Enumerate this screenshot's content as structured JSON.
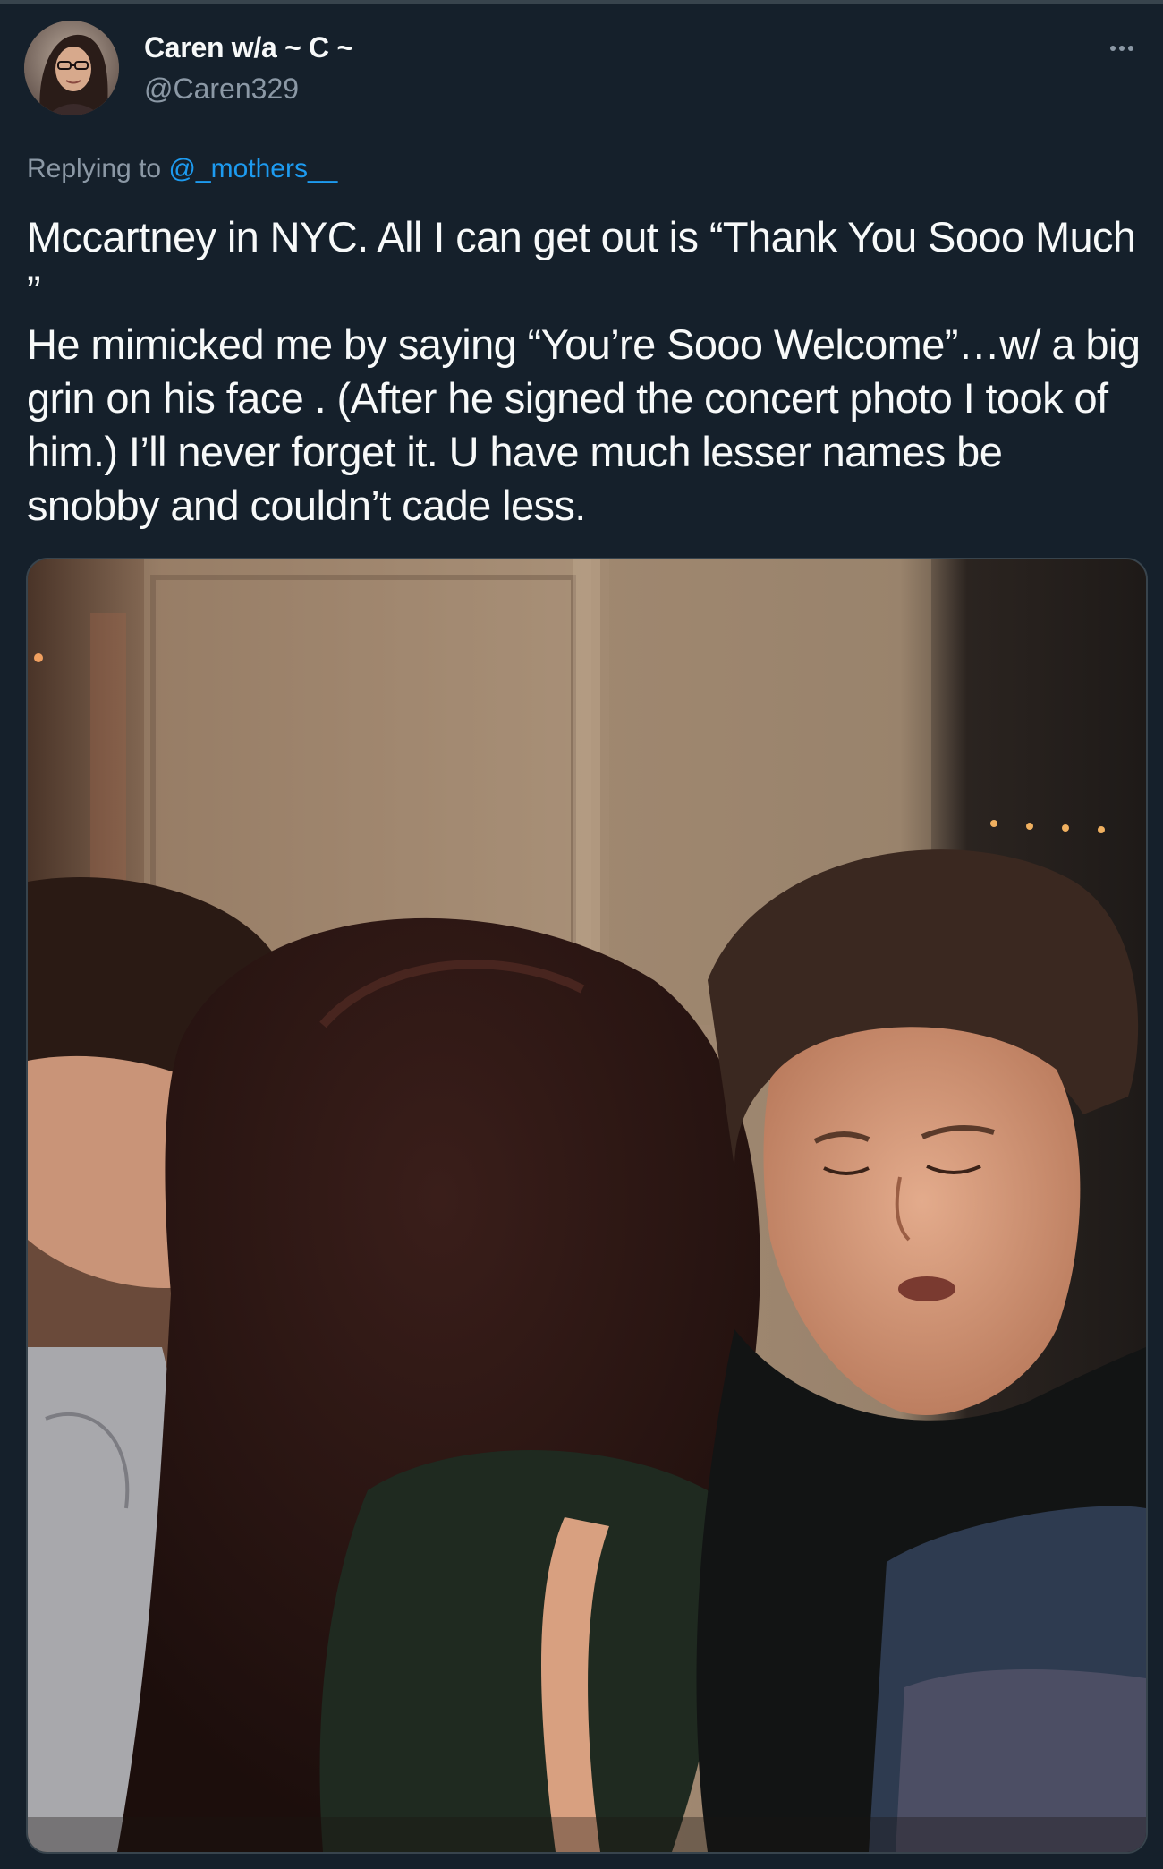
{
  "tweet": {
    "display_name": "Caren w/a ~ C ~",
    "handle": "@Caren329",
    "reply_prefix": "Replying to ",
    "reply_mention": "@_mothers__",
    "text": "Mccartney in NYC. All I can get out is “Thank You Sooo Much ”\nHe mimicked me by saying “You’re Sooo Welcome”…w/ a big grin on his face . (After he signed the concert photo I took of him.) I’ll never forget it. U have much lesser names be snobby and couldn’t cade less."
  },
  "icons": {
    "more": "more-horizontal-icon"
  },
  "colors": {
    "background": "#15202b",
    "text_primary": "#f7f9f9",
    "text_secondary": "#8b98a5",
    "link": "#1d9bf0",
    "border": "#38444d"
  }
}
